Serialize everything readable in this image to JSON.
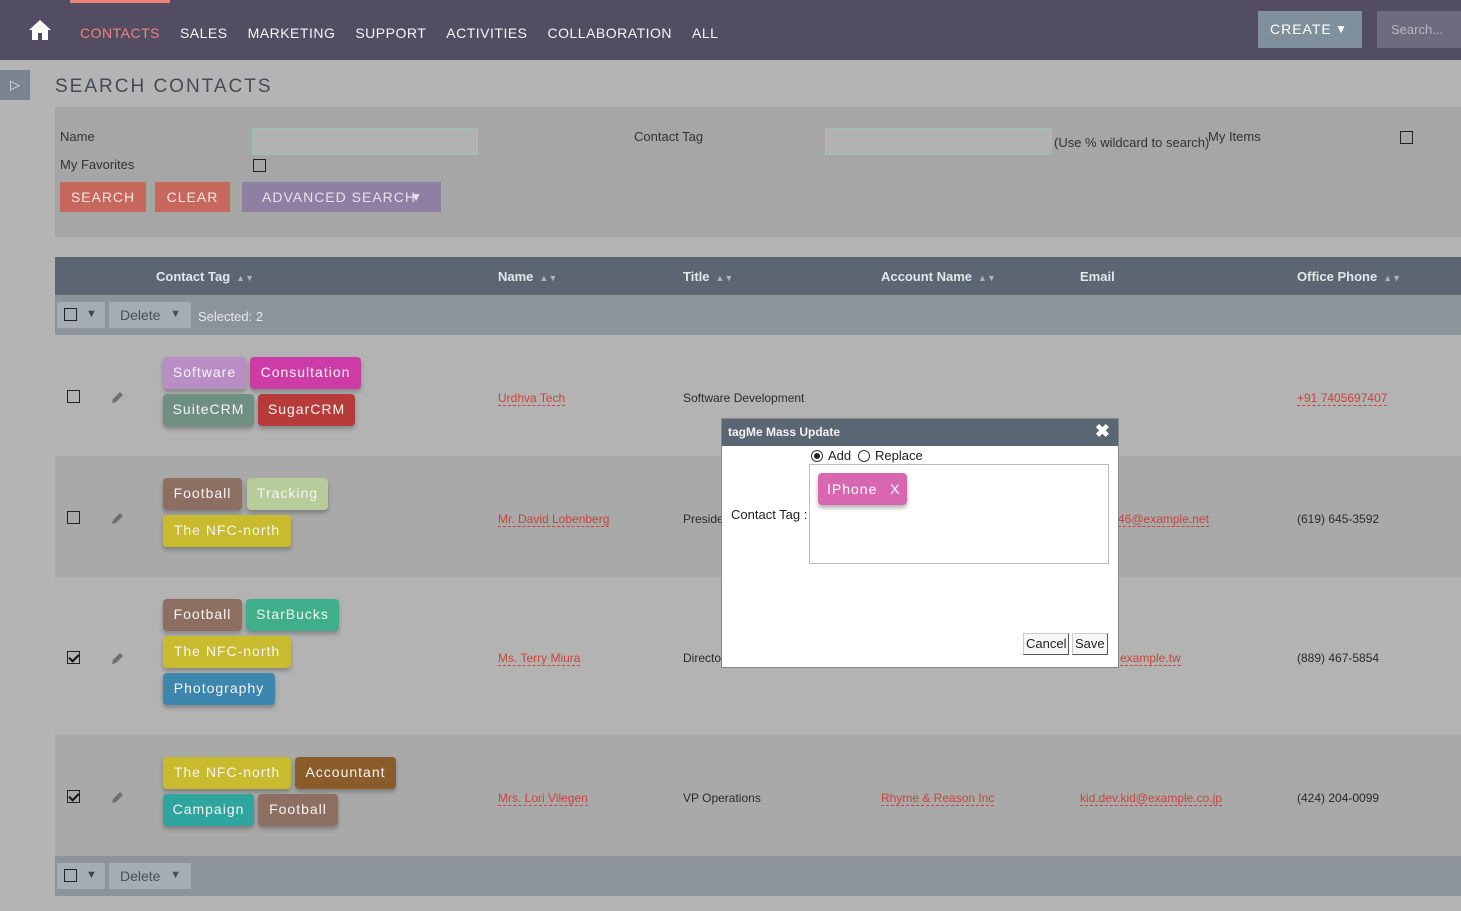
{
  "nav": {
    "items": [
      "CONTACTS",
      "SALES",
      "MARKETING",
      "SUPPORT",
      "ACTIVITIES",
      "COLLABORATION",
      "ALL"
    ],
    "create_label": "CREATE",
    "search_placeholder": "Search..."
  },
  "page_title": "SEARCH CONTACTS",
  "search": {
    "name_label": "Name",
    "contact_tag_label": "Contact Tag",
    "wildcard_hint": "(Use % wildcard to search)",
    "my_items_label": "My Items",
    "my_favorites_label": "My Favorites",
    "search_btn": "SEARCH",
    "clear_btn": "CLEAR",
    "advanced_btn": "ADVANCED SEARCH"
  },
  "table": {
    "headers": [
      "Contact Tag",
      "Name",
      "Title",
      "Account Name",
      "Email",
      "Office Phone"
    ],
    "delete_label": "Delete",
    "selected_text": "Selected: 2",
    "rows": [
      {
        "checked": false,
        "tags": [
          {
            "label": "Software",
            "color": "#b98ec4"
          },
          {
            "label": "Consultation",
            "color": "#cc3ba6"
          },
          {
            "label": "SuiteCRM",
            "color": "#6e8f82"
          },
          {
            "label": "SugarCRM",
            "color": "#b83b3b"
          }
        ],
        "name": "Urdhva Tech",
        "title": "Software Development",
        "account": "",
        "email": "",
        "phone": "+91 7405697407"
      },
      {
        "checked": false,
        "tags": [
          {
            "label": "Football",
            "color": "#8d6f62"
          },
          {
            "label": "Tracking",
            "color": "#b6cc9a"
          },
          {
            "label": "The NFC-north",
            "color": "#c8bb2e"
          }
        ],
        "name": "Mr. David Lobenberg",
        "title": "Preside",
        "account": "",
        "email": "46@example.net",
        "phone": "(619) 645-3592"
      },
      {
        "checked": true,
        "tags": [
          {
            "label": "Football",
            "color": "#8d6f62"
          },
          {
            "label": "StarBucks",
            "color": "#3fae8a"
          },
          {
            "label": "The NFC-north",
            "color": "#c8bb2e"
          },
          {
            "label": "Photography",
            "color": "#3d86ad"
          }
        ],
        "name": "Ms. Terry Miura",
        "title": "Directo",
        "account": "",
        "email": "example.tw",
        "phone": "(889) 467-5854"
      },
      {
        "checked": true,
        "tags": [
          {
            "label": "The NFC-north",
            "color": "#c8bb2e"
          },
          {
            "label": "Accountant",
            "color": "#8a5c2a"
          },
          {
            "label": "Campaign",
            "color": "#2fa5a0"
          },
          {
            "label": "Football",
            "color": "#8d6f62"
          }
        ],
        "name": "Mrs. Lori Vilegen",
        "title": "VP Operations",
        "account": "Rhyme & Reason Inc",
        "email": "kid.dev.kid@example.co.jp",
        "phone": "(424) 204-0099"
      }
    ]
  },
  "modal": {
    "title": "tagMe Mass Update",
    "add_label": "Add",
    "replace_label": "Replace",
    "mode": "add",
    "field_label": "Contact Tag :",
    "tag_label": "IPhone",
    "tag_remove": "X",
    "cancel_label": "Cancel",
    "save_label": "Save"
  }
}
